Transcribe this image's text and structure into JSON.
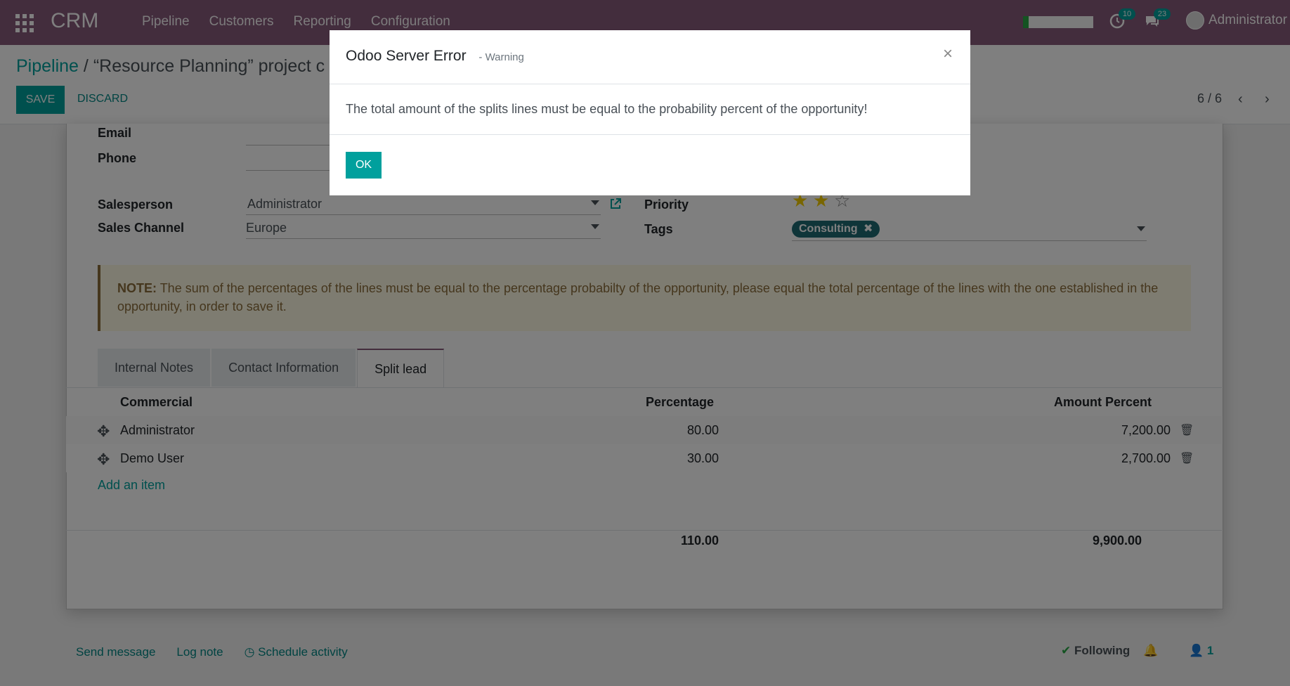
{
  "navbar": {
    "brand": "CRM",
    "menu": [
      "Pipeline",
      "Customers",
      "Reporting",
      "Configuration"
    ],
    "activity_count": "10",
    "message_count": "23",
    "user": "Administrator",
    "progress": 0.08
  },
  "control": {
    "breadcrumb_root": "Pipeline",
    "breadcrumb_sep": "/",
    "breadcrumb_current": "“Resource Planning” project c",
    "save_label": "SAVE",
    "discard_label": "DISCARD",
    "pager": "6 / 6"
  },
  "form": {
    "email_label": "Email",
    "phone_label": "Phone",
    "salesperson_label": "Salesperson",
    "salesperson_value": "Administrator",
    "sales_channel_label": "Sales Channel",
    "sales_channel_value": "Europe",
    "priority_label": "Priority",
    "priority_stars": 2,
    "tags_label": "Tags",
    "tag": "Consulting",
    "note_prefix": "NOTE:",
    "note_text": "The sum of the percentages of the lines must be equal to the percentage probabilty of the opportunity, please equal the total percentage of the lines with the one established in the opportunity, in order to save it."
  },
  "tabs": [
    "Internal Notes",
    "Contact Information",
    "Split lead"
  ],
  "table": {
    "headers": [
      "Commercial",
      "Percentage",
      "Amount Percent"
    ],
    "rows": [
      [
        "Administrator",
        "80.00",
        "7,200.00"
      ],
      [
        "Demo User",
        "30.00",
        "2,700.00"
      ]
    ],
    "add_item": "Add an item",
    "total_percentage": "110.00",
    "total_amount": "9,900.00"
  },
  "chatter": {
    "send_message": "Send message",
    "log_note": "Log note",
    "schedule_activity": "Schedule activity",
    "following": "Following",
    "followers": "1"
  },
  "modal": {
    "title": "Odoo Server Error",
    "subtitle": "- Warning",
    "close": "×",
    "message": "The total amount of the splits lines must be equal to the probability percent of the opportunity!",
    "ok_label": "OK"
  }
}
